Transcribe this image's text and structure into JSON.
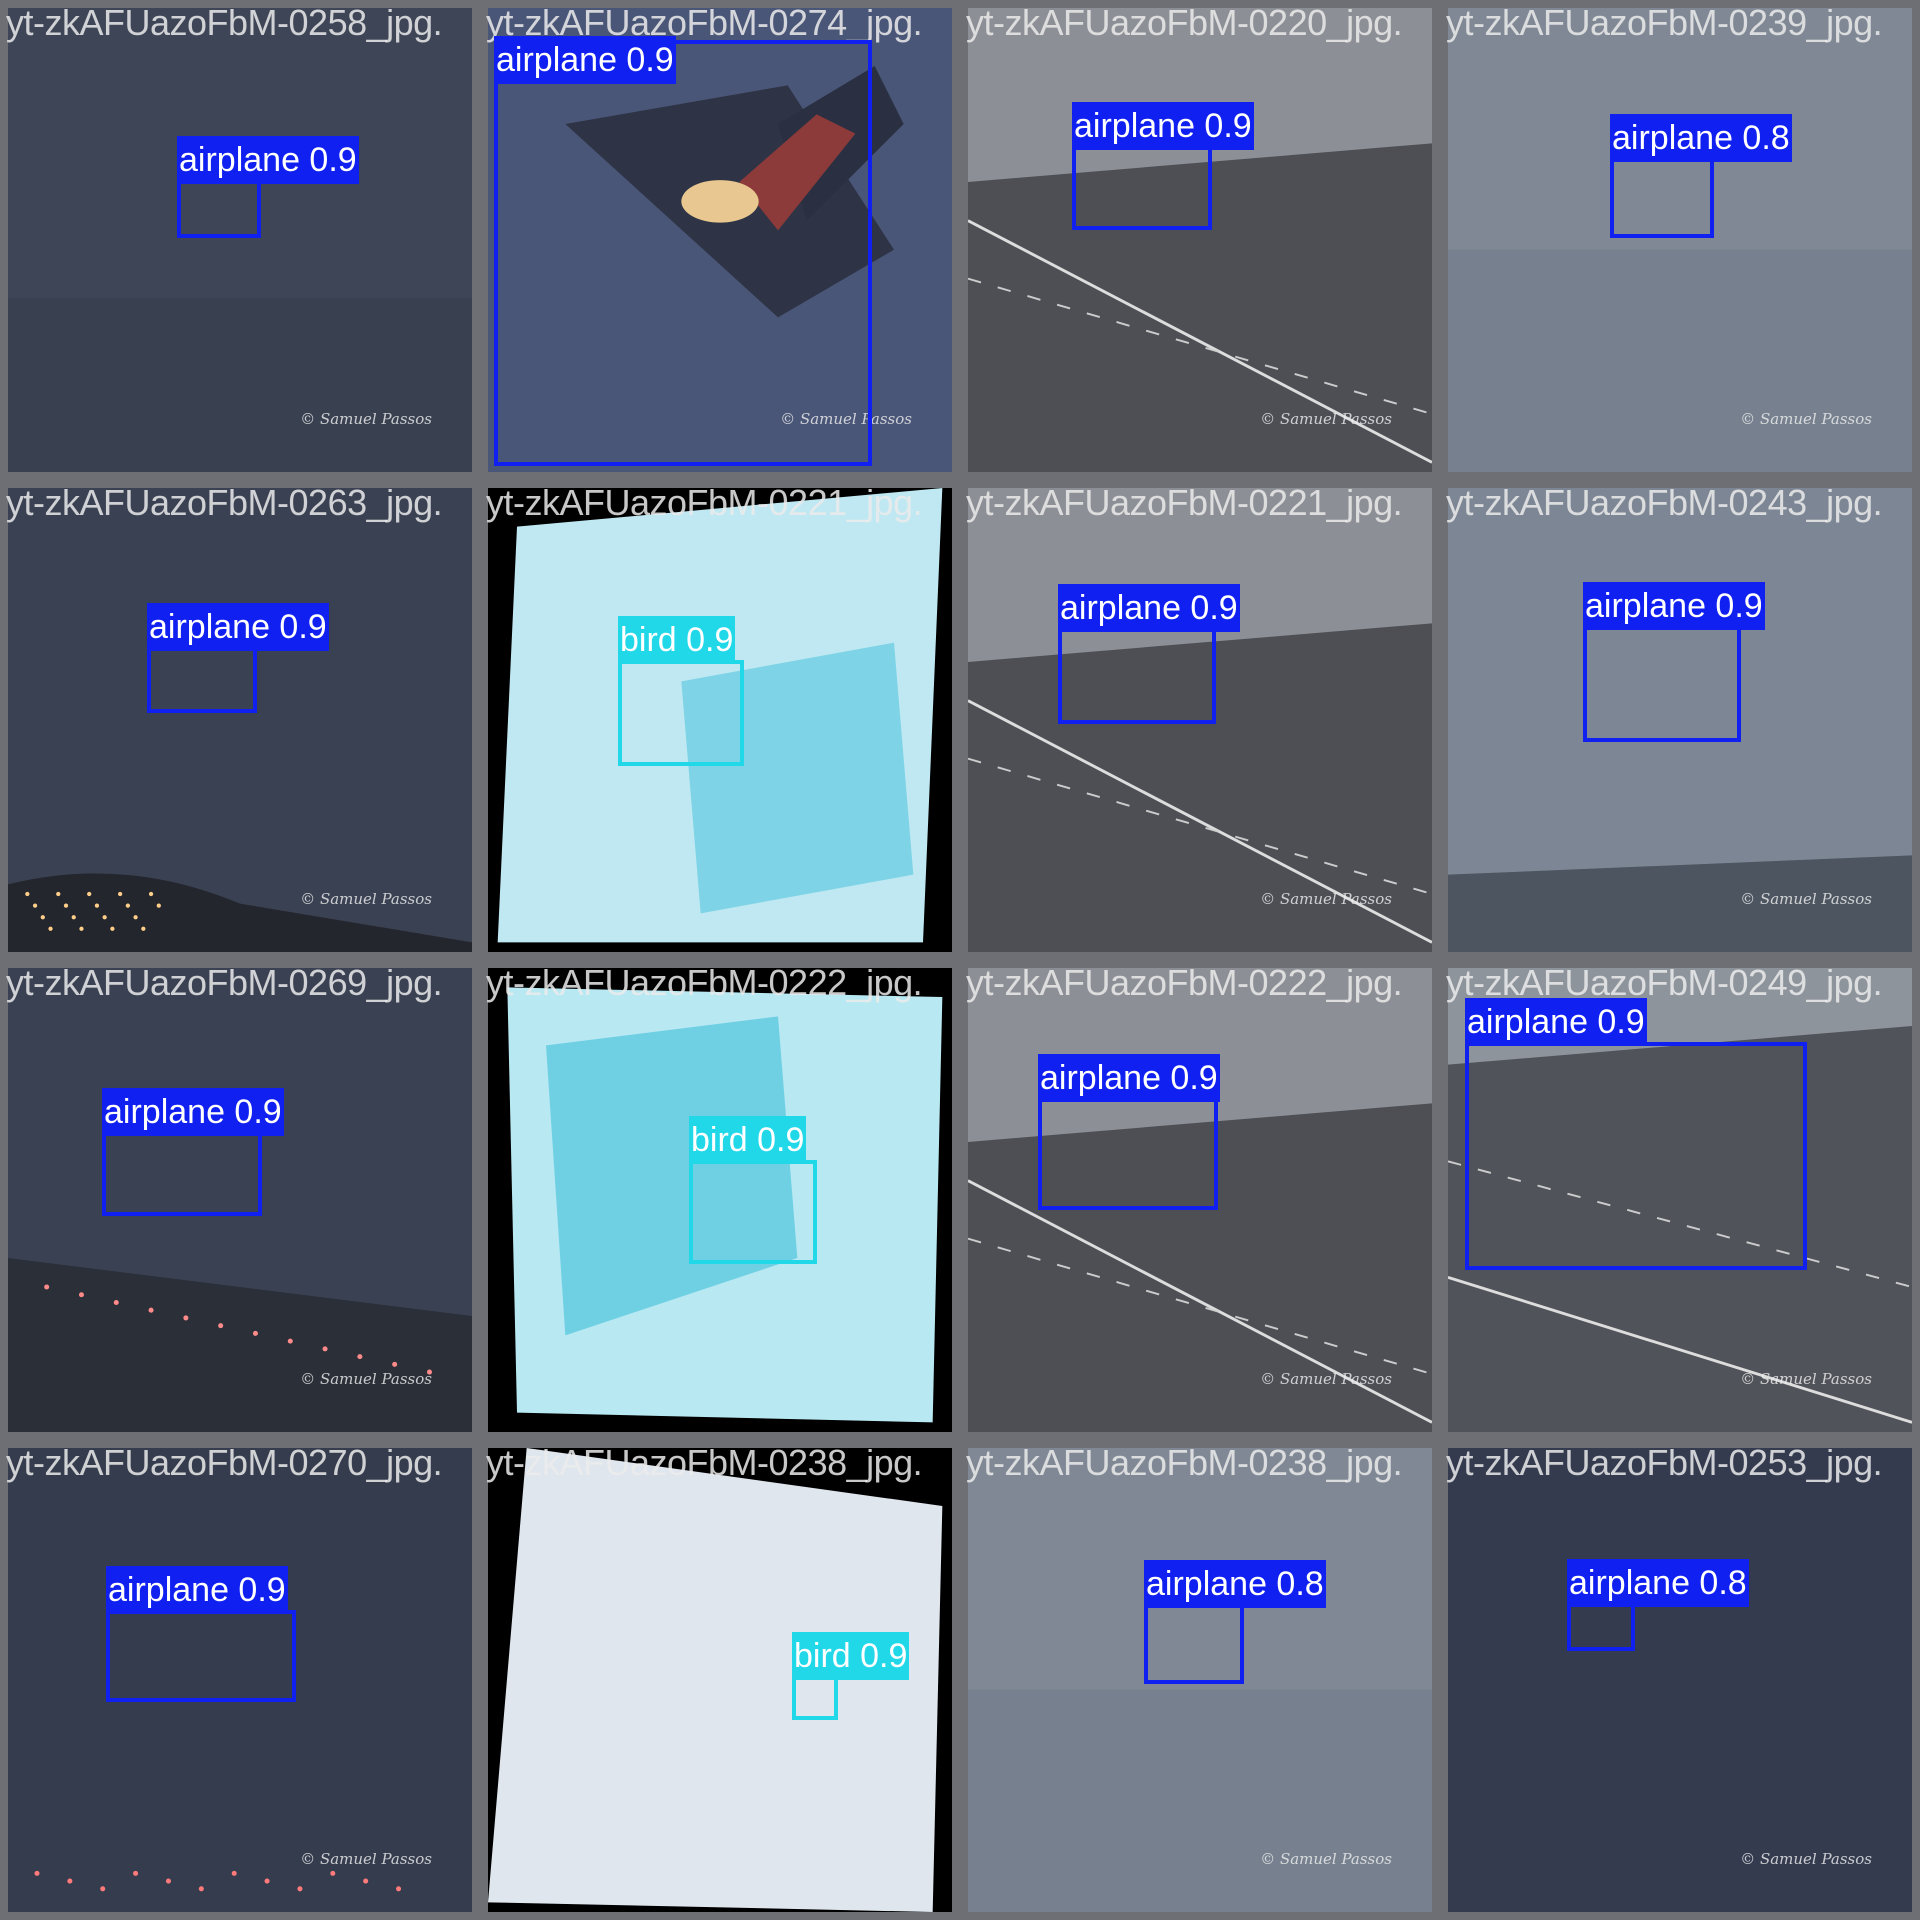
{
  "colors": {
    "airplane": "#1020f0",
    "bird": "#20d8e8",
    "label_text": "#ffffff"
  },
  "tiles": [
    {
      "filename": "yt-zkAFUazoFbM-0258_jpg.",
      "scene": "night",
      "credit": "© Samuel Passos",
      "detections": [
        {
          "label": "airplane 0.9",
          "cls": "airplane"
        }
      ]
    },
    {
      "filename": "yt-zkAFUazoFbM-0274_jpg.",
      "scene": "closeup",
      "credit": "© Samuel Passos",
      "detections": [
        {
          "label": "airplane 0.9",
          "cls": "airplane"
        }
      ]
    },
    {
      "filename": "yt-zkAFUazoFbM-0220_jpg.",
      "scene": "runway",
      "credit": "© Samuel Passos",
      "detections": [
        {
          "label": "airplane 0.9",
          "cls": "airplane"
        }
      ]
    },
    {
      "filename": "yt-zkAFUazoFbM-0239_jpg.",
      "scene": "haze",
      "credit": "© Samuel Passos",
      "detections": [
        {
          "label": "airplane 0.8",
          "cls": "airplane"
        }
      ]
    },
    {
      "filename": "yt-zkAFUazoFbM-0263_jpg.",
      "scene": "night-shore",
      "credit": "© Samuel Passos",
      "detections": [
        {
          "label": "airplane 0.9",
          "cls": "airplane"
        }
      ]
    },
    {
      "filename": "yt-zkAFUazoFbM-0221_jpg.",
      "scene": "sky-bird",
      "credit": "",
      "detections": [
        {
          "label": "bird 0.9",
          "cls": "bird"
        }
      ]
    },
    {
      "filename": "yt-zkAFUazoFbM-0221_jpg.",
      "scene": "runway",
      "credit": "© Samuel Passos",
      "detections": [
        {
          "label": "airplane 0.9",
          "cls": "airplane"
        }
      ]
    },
    {
      "filename": "yt-zkAFUazoFbM-0243_jpg.",
      "scene": "haze-shore",
      "credit": "© Samuel Passos",
      "detections": [
        {
          "label": "airplane 0.9",
          "cls": "airplane"
        }
      ]
    },
    {
      "filename": "yt-zkAFUazoFbM-0269_jpg.",
      "scene": "night-lights",
      "credit": "© Samuel Passos",
      "detections": [
        {
          "label": "airplane 0.9",
          "cls": "airplane"
        }
      ]
    },
    {
      "filename": "yt-zkAFUazoFbM-0222_jpg.",
      "scene": "sky-bird2",
      "credit": "",
      "detections": [
        {
          "label": "bird 0.9",
          "cls": "bird"
        }
      ]
    },
    {
      "filename": "yt-zkAFUazoFbM-0222_jpg.",
      "scene": "runway",
      "credit": "© Samuel Passos",
      "detections": [
        {
          "label": "airplane 0.9",
          "cls": "airplane"
        }
      ]
    },
    {
      "filename": "yt-zkAFUazoFbM-0249_jpg.",
      "scene": "runway-close",
      "credit": "© Samuel Passos",
      "detections": [
        {
          "label": "airplane 0.9",
          "cls": "airplane"
        }
      ]
    },
    {
      "filename": "yt-zkAFUazoFbM-0270_jpg.",
      "scene": "night-lights2",
      "credit": "© Samuel Passos",
      "detections": [
        {
          "label": "airplane 0.9",
          "cls": "airplane"
        }
      ]
    },
    {
      "filename": "yt-zkAFUazoFbM-0238_jpg.",
      "scene": "pale-sky",
      "credit": "",
      "detections": [
        {
          "label": "bird 0.9",
          "cls": "bird"
        }
      ]
    },
    {
      "filename": "yt-zkAFUazoFbM-0238_jpg.",
      "scene": "haze",
      "credit": "© Samuel Passos",
      "detections": [
        {
          "label": "airplane 0.8",
          "cls": "airplane"
        }
      ]
    },
    {
      "filename": "yt-zkAFUazoFbM-0253_jpg.",
      "scene": "dusk",
      "credit": "© Samuel Passos",
      "detections": [
        {
          "label": "airplane 0.8",
          "cls": "airplane"
        }
      ]
    }
  ]
}
